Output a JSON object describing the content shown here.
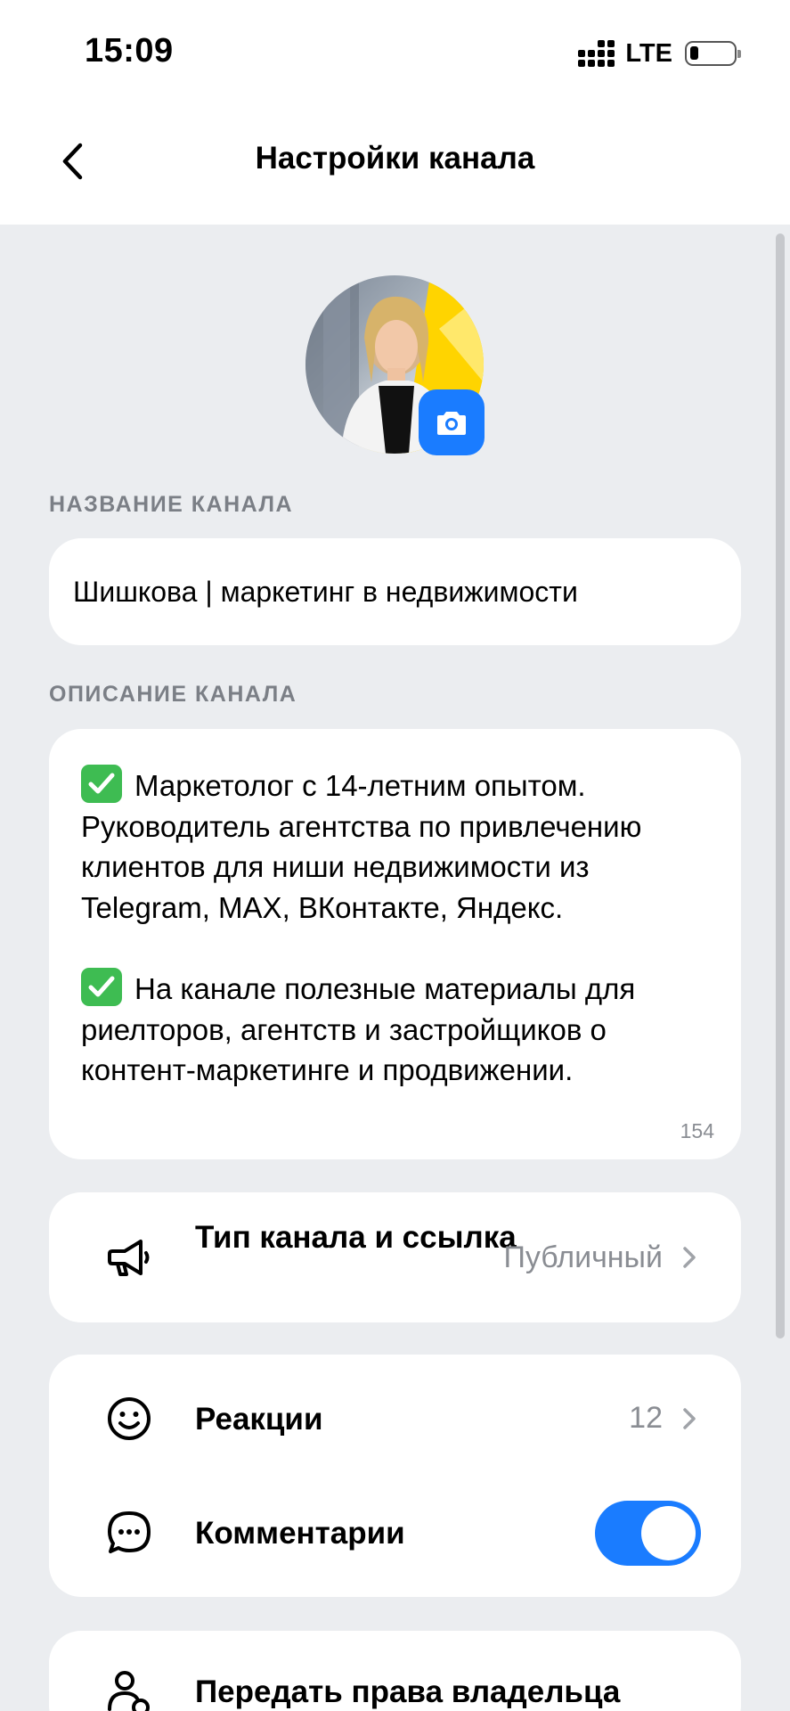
{
  "status": {
    "time": "15:09",
    "network": "LTE"
  },
  "nav": {
    "title": "Настройки канала"
  },
  "channel": {
    "name_label": "НАЗВАНИЕ КАНАЛА",
    "name_value": "Шишкова | маркетинг в недвижимости",
    "description_label": "ОПИСАНИЕ КАНАЛА",
    "description_paragraph_1": "Маркетолог с 14-летним опытом. Руководитель агентства по привлечению клиентов для ниши недвижимости из Telegram, MAX, ВКонтакте, Яндекс.",
    "description_paragraph_2": "На канале полезные материалы для риелторов, агентств и застройщиков о контент-маркетинге и продвижении.",
    "description_counter": "154"
  },
  "settings": {
    "channel_type_label": "Тип канала и ссылка",
    "channel_type_value": "Публичный",
    "reactions_label": "Реакции",
    "reactions_value": "12",
    "comments_label": "Комментарии",
    "comments_enabled": true,
    "transfer_label": "Передать права владельца"
  },
  "icons": {
    "back": "chevron-left-icon",
    "camera": "camera-icon",
    "channel_type": "megaphone-icon",
    "reactions": "smile-icon",
    "comments": "chat-bubble-icon",
    "transfer": "user-transfer-icon",
    "check": "check-mark-icon"
  },
  "colors": {
    "accent": "#1a7cff",
    "background": "#ebedf0",
    "card": "#ffffff",
    "secondary_text": "#8a8d93",
    "check_green": "#3ebc52"
  }
}
